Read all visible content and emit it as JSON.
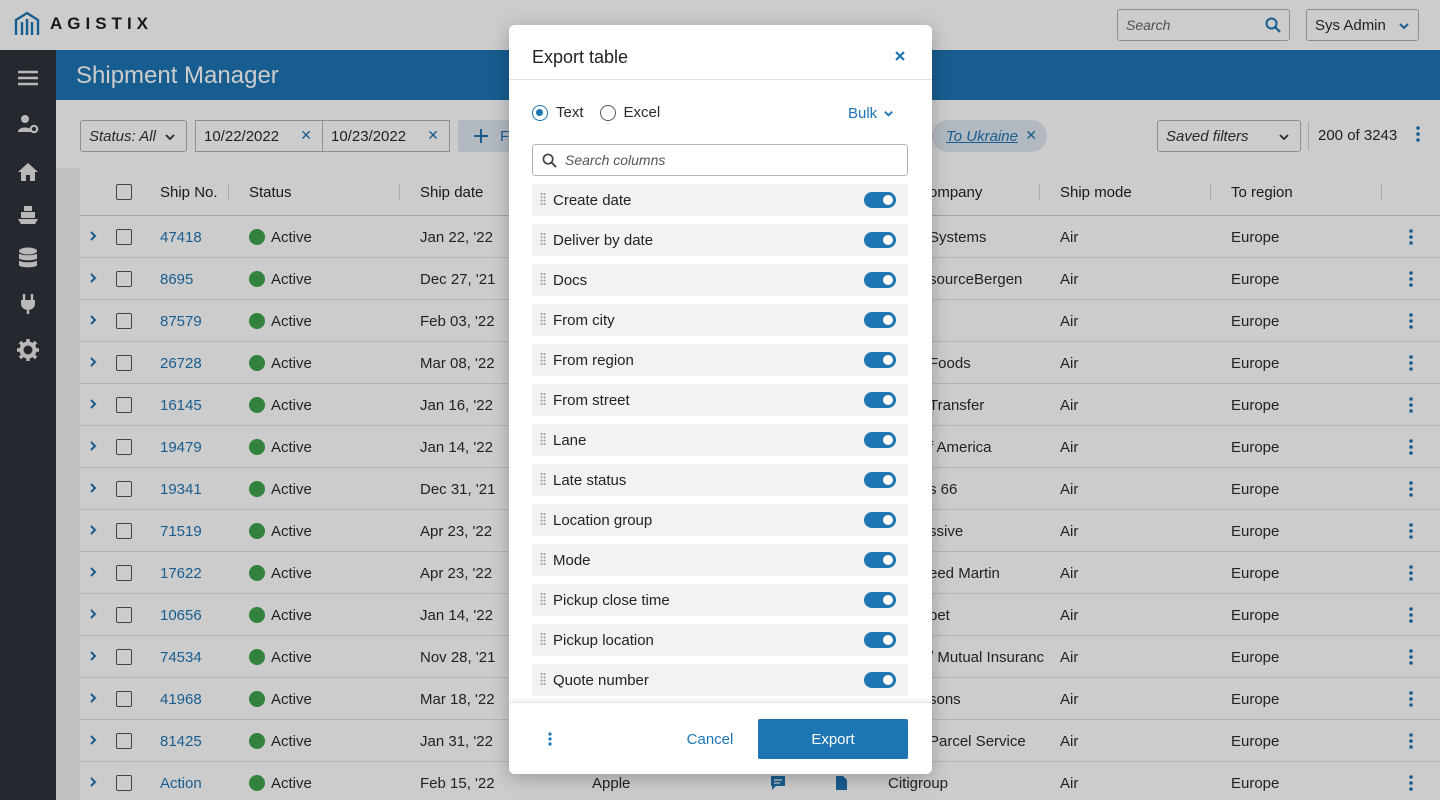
{
  "app": {
    "logo_text": "AGISTIX"
  },
  "topbar": {
    "search_placeholder": "Search",
    "user_label": "Sys Admin"
  },
  "page": {
    "title": "Shipment Manager"
  },
  "filters": {
    "status_label": "Status: All",
    "date_from": "10/22/2022",
    "date_to": "10/23/2022",
    "add_filter_label": "F",
    "tag_label": "To Ukraine",
    "saved_filters_placeholder": "Saved filters",
    "count_text": "200 of 3243"
  },
  "table": {
    "columns": [
      "Ship No.",
      "Status",
      "Ship date",
      "ompany",
      "Ship mode",
      "To region"
    ],
    "rows": [
      {
        "ship_no": "47418",
        "status": "Active",
        "ship_date": "Jan 22, '22",
        "company": "Systems",
        "mode": "Air",
        "region": "Europe"
      },
      {
        "ship_no": "8695",
        "status": "Active",
        "ship_date": "Dec 27, '21",
        "company": "sourceBergen",
        "mode": "Air",
        "region": "Europe"
      },
      {
        "ship_no": "87579",
        "status": "Active",
        "ship_date": "Feb 03, '22",
        "company": "",
        "mode": "Air",
        "region": "Europe"
      },
      {
        "ship_no": "26728",
        "status": "Active",
        "ship_date": "Mar 08, '22",
        "company": "Foods",
        "mode": "Air",
        "region": "Europe"
      },
      {
        "ship_no": "16145",
        "status": "Active",
        "ship_date": "Jan 16, '22",
        "company": "Transfer",
        "mode": "Air",
        "region": "Europe"
      },
      {
        "ship_no": "19479",
        "status": "Active",
        "ship_date": "Jan 14, '22",
        "company": "f America",
        "mode": "Air",
        "region": "Europe"
      },
      {
        "ship_no": "19341",
        "status": "Active",
        "ship_date": "Dec 31, '21",
        "company": "s 66",
        "mode": "Air",
        "region": "Europe"
      },
      {
        "ship_no": "71519",
        "status": "Active",
        "ship_date": "Apr 23, '22",
        "company": "ssive",
        "mode": "Air",
        "region": "Europe"
      },
      {
        "ship_no": "17622",
        "status": "Active",
        "ship_date": "Apr 23, '22",
        "company": "eed Martin",
        "mode": "Air",
        "region": "Europe"
      },
      {
        "ship_no": "10656",
        "status": "Active",
        "ship_date": "Jan 14, '22",
        "company": "pet",
        "mode": "Air",
        "region": "Europe"
      },
      {
        "ship_no": "74534",
        "status": "Active",
        "ship_date": "Nov 28, '21",
        "company": "/ Mutual Insuranc",
        "mode": "Air",
        "region": "Europe"
      },
      {
        "ship_no": "41968",
        "status": "Active",
        "ship_date": "Mar 18, '22",
        "company": "sons",
        "mode": "Air",
        "region": "Europe"
      },
      {
        "ship_no": "81425",
        "status": "Active",
        "ship_date": "Jan 31, '22",
        "company": "Parcel Service",
        "mode": "Air",
        "region": "Europe"
      },
      {
        "ship_no": "Action",
        "status": "Active",
        "ship_date": "Feb 15, '22",
        "carrier": "Apple",
        "company": "Citigroup",
        "mode": "Air",
        "region": "Europe"
      }
    ]
  },
  "modal": {
    "title": "Export table",
    "format_text": "Text",
    "format_excel": "Excel",
    "bulk_label": "Bulk",
    "search_placeholder": "Search columns",
    "columns": [
      {
        "label": "Create date",
        "enabled": true
      },
      {
        "label": "Deliver by date",
        "enabled": true
      },
      {
        "label": "Docs",
        "enabled": true
      },
      {
        "label": "From city",
        "enabled": true
      },
      {
        "label": "From region",
        "enabled": true
      },
      {
        "label": "From street",
        "enabled": true
      },
      {
        "label": "Lane",
        "enabled": true
      },
      {
        "label": "Late status",
        "enabled": true
      },
      {
        "label": "Location group",
        "enabled": true
      },
      {
        "label": "Mode",
        "enabled": true
      },
      {
        "label": "Pickup close time",
        "enabled": true
      },
      {
        "label": "Pickup location",
        "enabled": true
      },
      {
        "label": "Quote number",
        "enabled": true
      }
    ],
    "cancel_label": "Cancel",
    "export_label": "Export"
  },
  "colors": {
    "brand": "#1e75b3",
    "sidenav": "#2f343b",
    "status_active": "#3fa34d"
  }
}
